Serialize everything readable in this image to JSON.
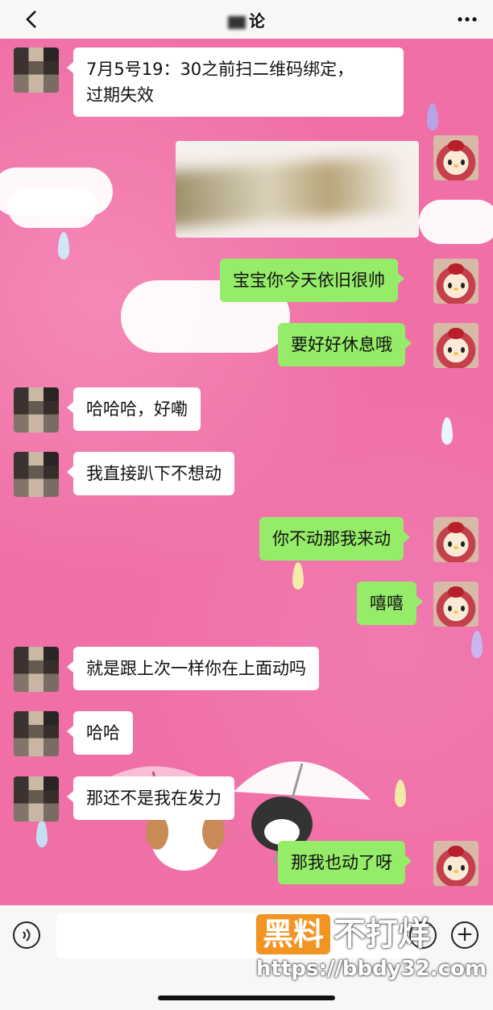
{
  "header": {
    "title": "论",
    "back_icon": "chevron-left-icon",
    "more_icon": "more-dots-icon"
  },
  "messages": [
    {
      "side": "in",
      "text": "7月5号19：30之前扫二维码绑定，"
    },
    {
      "side": "in",
      "text": "过期失效"
    },
    {
      "side": "out",
      "text": "宝宝你今天依旧很帅"
    },
    {
      "side": "out",
      "text": "要好好休息哦"
    },
    {
      "side": "in",
      "text": "哈哈哈，好嘞"
    },
    {
      "side": "in",
      "text": "我直接趴下不想动"
    },
    {
      "side": "out",
      "text": "你不动那我来动"
    },
    {
      "side": "out",
      "text": "嘻嘻"
    },
    {
      "side": "in",
      "text": "就是跟上次一样你在上面动吗"
    },
    {
      "side": "in",
      "text": "哈哈"
    },
    {
      "side": "in",
      "text": "那还不是我在发力"
    },
    {
      "side": "out",
      "text": "那我也动了呀"
    }
  ],
  "input": {
    "voice_icon": "voice-icon",
    "emoji_icon": "emoji-icon",
    "plus_icon": "plus-icon",
    "plus_glyph": "+"
  },
  "watermark": {
    "box_text": "黑料",
    "text": "不打烊",
    "url": "https://bbdy32.com"
  },
  "colors": {
    "wallpaper": "#ef6fa6",
    "bubble_in": "#ffffff",
    "bubble_out": "#95ec69",
    "watermark_box": "#f29422"
  }
}
